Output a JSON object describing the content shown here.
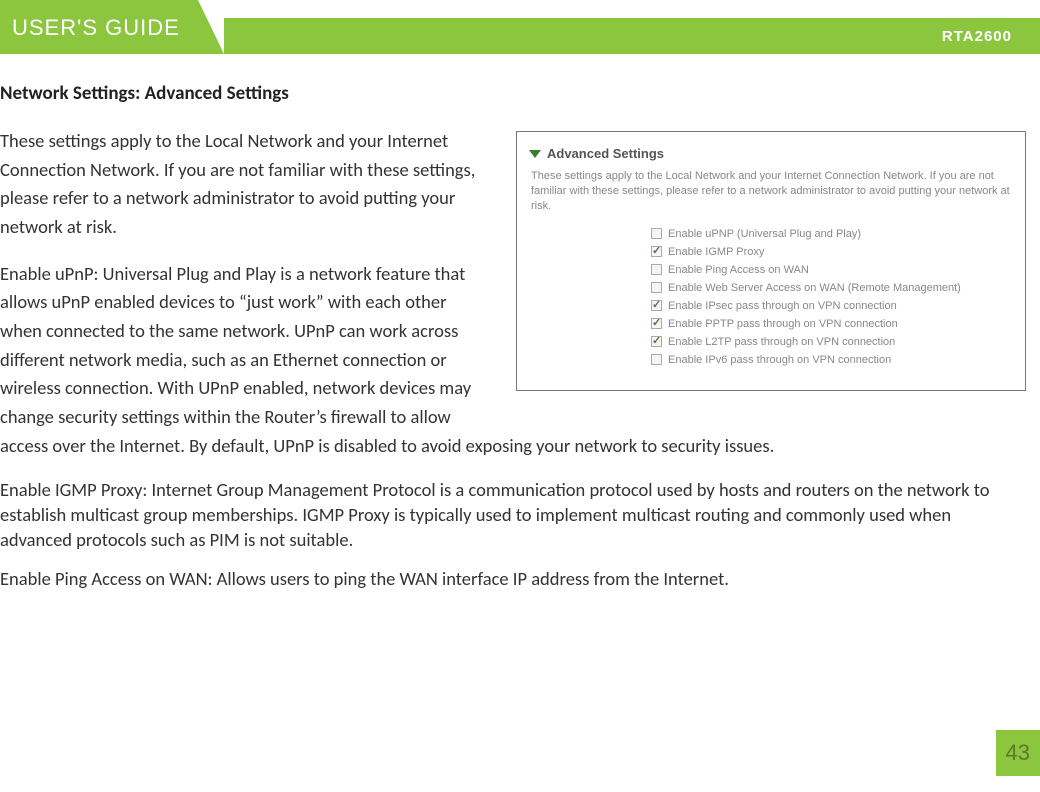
{
  "header": {
    "guide_label": "USER'S GUIDE",
    "model": "RTA2600"
  },
  "section_title": "Network Settings: Advanced Settings",
  "paragraphs": {
    "intro": "These settings apply to the Local Network and your Internet Connection Network.  If you are not familiar with these settings, please refer to a network administrator to avoid putting your network at risk.",
    "upnp": "Enable uPnP: Universal Plug and Play is a network feature that allows uPnP enabled devices to “just work” with each other when connected to the same network.  UPnP can work across different network media, such as an Ethernet connection or wireless connection.  With UPnP enabled, network devices may change security settings within the Router’s firewall to allow access over the Internet.  By default, UPnP is disabled to avoid exposing your network to security issues.",
    "igmp": "Enable IGMP Proxy: Internet Group Management Protocol is a communication protocol used by hosts and routers on the network to establish multicast group memberships.  IGMP Proxy is typically used to implement multicast routing and commonly used when advanced protocols such as PIM is not suitable.",
    "ping": "Enable Ping Access on WAN: Allows users to ping the WAN interface IP address from the Internet."
  },
  "screenshot": {
    "title": "Advanced Settings",
    "desc": "These settings apply to the Local Network and your Internet Connection Network.  If you are not familiar with these settings, please refer to a network administrator to avoid putting your network at risk.",
    "options": [
      {
        "label": "Enable uPNP (Universal Plug and Play)",
        "checked": false
      },
      {
        "label": "Enable IGMP Proxy",
        "checked": true
      },
      {
        "label": "Enable Ping Access on WAN",
        "checked": false
      },
      {
        "label": "Enable Web Server Access on WAN (Remote Management)",
        "checked": false
      },
      {
        "label": "Enable IPsec pass through on VPN connection",
        "checked": true
      },
      {
        "label": "Enable PPTP pass through on VPN connection",
        "checked": true
      },
      {
        "label": "Enable L2TP pass through on VPN connection",
        "checked": true
      },
      {
        "label": "Enable IPv6 pass through on VPN connection",
        "checked": false
      }
    ]
  },
  "page_number": "43"
}
